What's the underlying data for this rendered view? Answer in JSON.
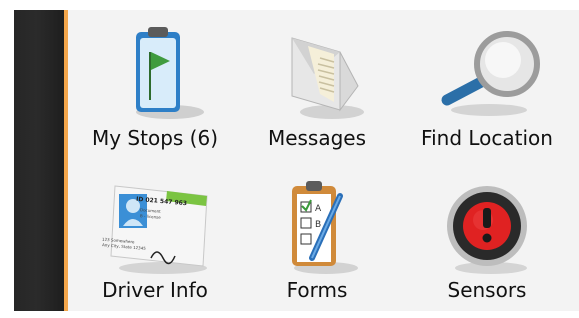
{
  "menu": {
    "items": [
      {
        "label": "My Stops (6)",
        "icon": "clipboard-flag-icon"
      },
      {
        "label": "Messages",
        "icon": "envelope-icon"
      },
      {
        "label": "Find Location",
        "icon": "magnifier-icon"
      },
      {
        "label": "Driver Info",
        "icon": "id-card-icon"
      },
      {
        "label": "Forms",
        "icon": "checklist-clipboard-icon"
      },
      {
        "label": "Sensors",
        "icon": "alert-gauge-icon"
      }
    ],
    "id_card": {
      "id_text": "ID 021 547 963",
      "doc_line1": "Document",
      "doc_line2": "B - license",
      "addr_line1": "123 Somewhere",
      "addr_line2": "Any City, State 12345"
    }
  },
  "colors": {
    "accent": "#f3a64b",
    "sidebar": "#262626",
    "panel": "#f3f3f3"
  }
}
